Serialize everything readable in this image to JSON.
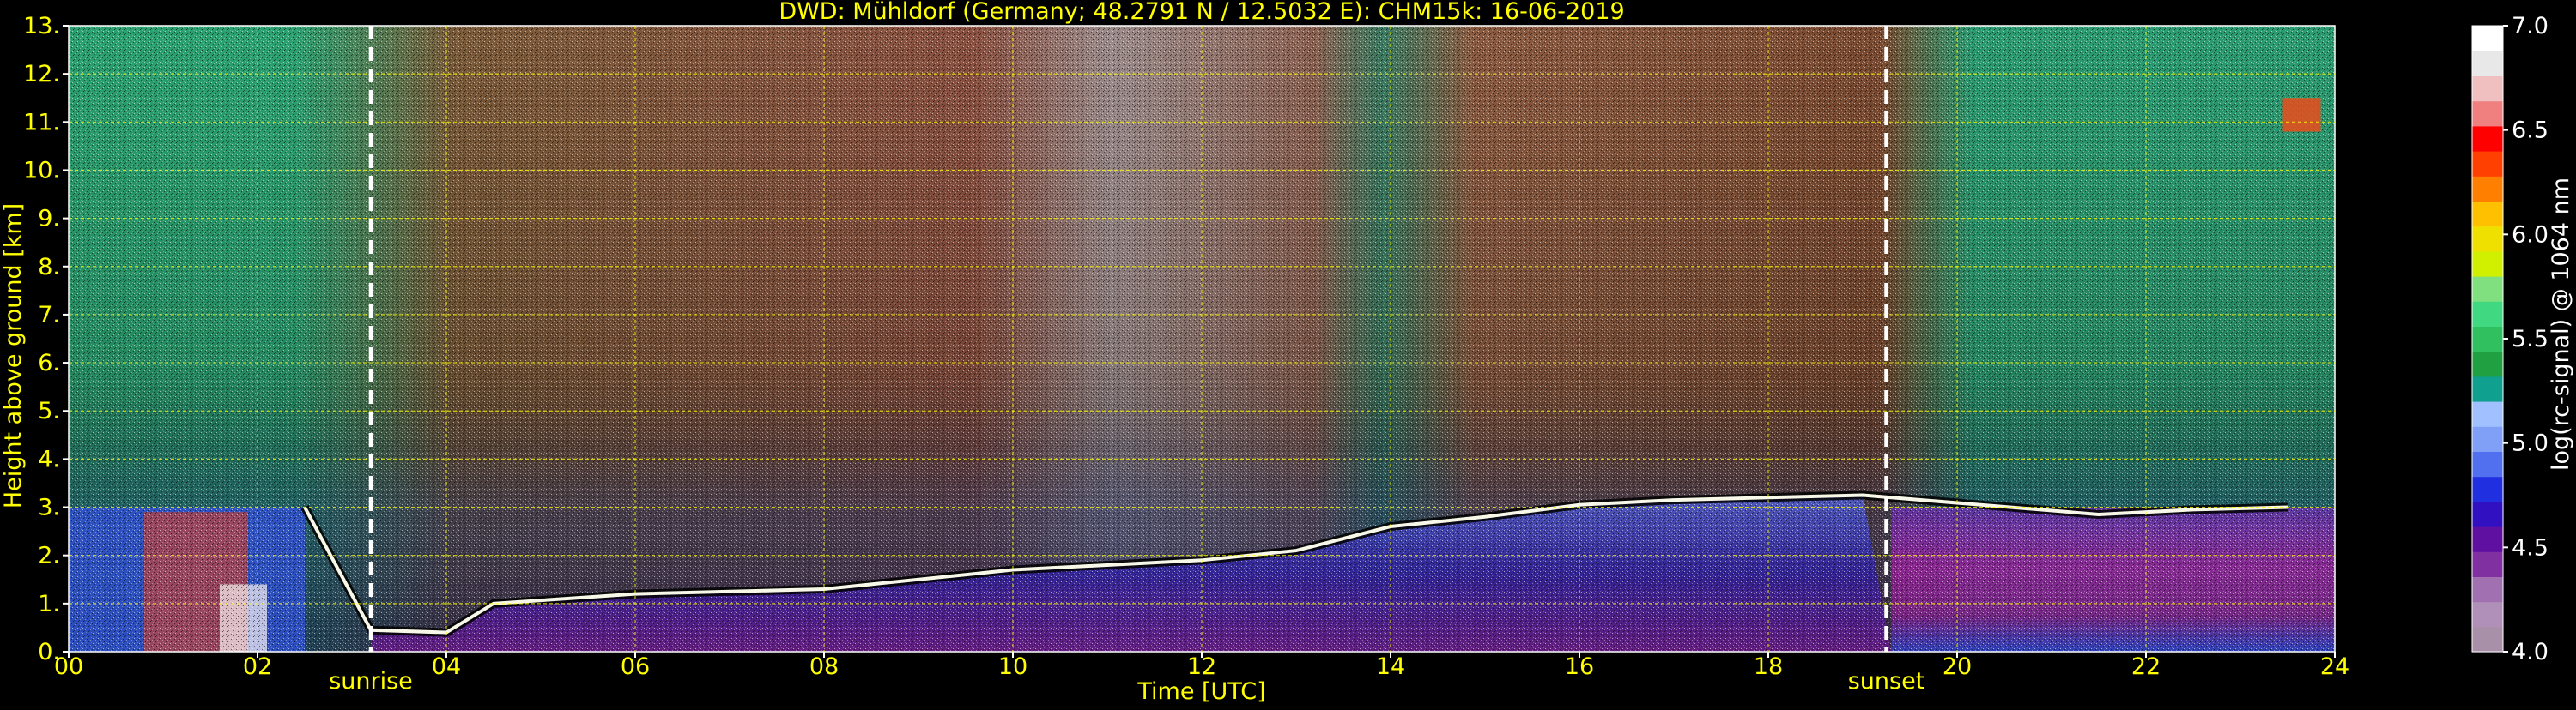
{
  "chart_data": {
    "type": "heatmap",
    "title": "DWD: Mühldorf (Germany; 48.2791 N / 12.5032 E):    CHM15k: 16-06-2019",
    "xlabel": "Time [UTC]",
    "ylabel": "Height above ground [km]",
    "xlim": [
      0,
      24
    ],
    "ylim": [
      0,
      13
    ],
    "x_ticks": [
      "00",
      "02",
      "04",
      "06",
      "08",
      "10",
      "12",
      "14",
      "16",
      "18",
      "20",
      "22",
      "24"
    ],
    "y_ticks": [
      "0.",
      "1.",
      "2.",
      "3.",
      "4.",
      "5.",
      "6.",
      "7.",
      "8.",
      "9.",
      "10.",
      "11.",
      "12.",
      "13."
    ],
    "grid": true,
    "colorbar": {
      "label": "log(rc-signal) @ 1064 nm",
      "range": [
        4.0,
        7.0
      ],
      "ticks": [
        "4.0",
        "4.5",
        "5.0",
        "5.5",
        "6.0",
        "6.5",
        "7.0"
      ]
    },
    "annotations": [
      {
        "text": "sunrise",
        "x": 3.2
      },
      {
        "text": "sunset",
        "x": 19.25
      }
    ],
    "cloud_base_km": [
      {
        "time": 2.5,
        "height": 3.0
      },
      {
        "time": 3.2,
        "height": 0.45
      },
      {
        "time": 4.0,
        "height": 0.4
      },
      {
        "time": 4.5,
        "height": 1.0
      },
      {
        "time": 6.0,
        "height": 1.2
      },
      {
        "time": 8.0,
        "height": 1.3
      },
      {
        "time": 10.0,
        "height": 1.7
      },
      {
        "time": 12.0,
        "height": 1.9
      },
      {
        "time": 13.0,
        "height": 2.1
      },
      {
        "time": 14.0,
        "height": 2.6
      },
      {
        "time": 15.0,
        "height": 2.8
      },
      {
        "time": 16.0,
        "height": 3.05
      },
      {
        "time": 17.0,
        "height": 3.15
      },
      {
        "time": 18.0,
        "height": 3.2
      },
      {
        "time": 19.0,
        "height": 3.25
      },
      {
        "time": 21.5,
        "height": 2.85
      },
      {
        "time": 22.5,
        "height": 2.95
      },
      {
        "time": 23.5,
        "height": 3.0
      }
    ],
    "colors": {
      "text": "#ffff00",
      "grid": "#ffff00",
      "background": "#000000",
      "colorscale": [
        "#a890a8",
        "#b090b8",
        "#a070b0",
        "#8030a0",
        "#6010a0",
        "#3010c0",
        "#2030e0",
        "#5070f0",
        "#80a0f8",
        "#a0c0ff",
        "#10a090",
        "#20a040",
        "#30c060",
        "#40d880",
        "#80e080",
        "#d0f000",
        "#f0e000",
        "#ffc000",
        "#ff8000",
        "#ff4000",
        "#ff0000",
        "#f08080",
        "#f0c0c0",
        "#e8e8e8",
        "#ffffff"
      ]
    }
  }
}
